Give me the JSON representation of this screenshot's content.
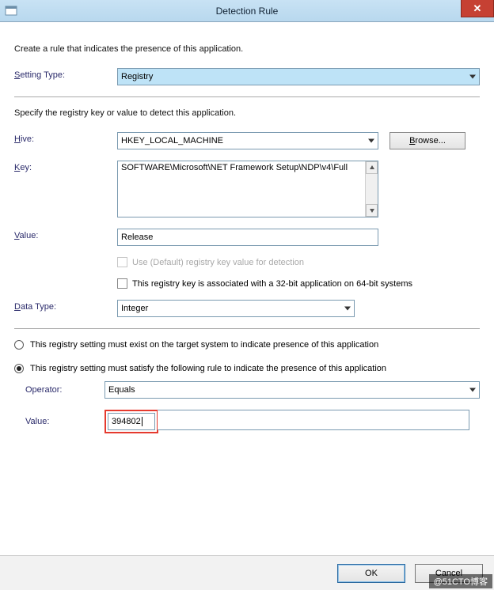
{
  "window": {
    "title": "Detection Rule",
    "close_glyph": "✕"
  },
  "intro1": "Create a rule that indicates the presence of this application.",
  "setting_type": {
    "label_pre": "S",
    "label_rest": "etting Type:",
    "value": "Registry"
  },
  "intro2": "Specify the registry key or value to detect this application.",
  "hive": {
    "label_pre": "H",
    "label_rest": "ive:",
    "value": "HKEY_LOCAL_MACHINE",
    "browse_pre": "B",
    "browse_rest": "rowse..."
  },
  "key": {
    "label_pre": "K",
    "label_rest": "ey:",
    "value": "SOFTWARE\\Microsoft\\NET Framework Setup\\NDP\\v4\\Full"
  },
  "value_field": {
    "label_pre": "V",
    "label_rest": "alue:",
    "value": "Release"
  },
  "use_default": {
    "label": "Use (Default) registry key value for detection"
  },
  "assoc_32": {
    "label": "This registry key is associated with a 32-bit application on 64-bit systems"
  },
  "data_type": {
    "label_pre": "D",
    "label_rest": "ata Type:",
    "value": "Integer"
  },
  "radio_exist": {
    "label": "This registry setting must exist on the target system to indicate presence of this application"
  },
  "radio_rule": {
    "label": "This registry setting must satisfy the following rule to indicate the presence of this application"
  },
  "operator": {
    "label": "Operator:",
    "value": "Equals"
  },
  "rule_value": {
    "label": "Value:",
    "value": "394802"
  },
  "footer": {
    "ok": "OK",
    "cancel": "Cancel"
  },
  "watermark": "@51CTO博客"
}
